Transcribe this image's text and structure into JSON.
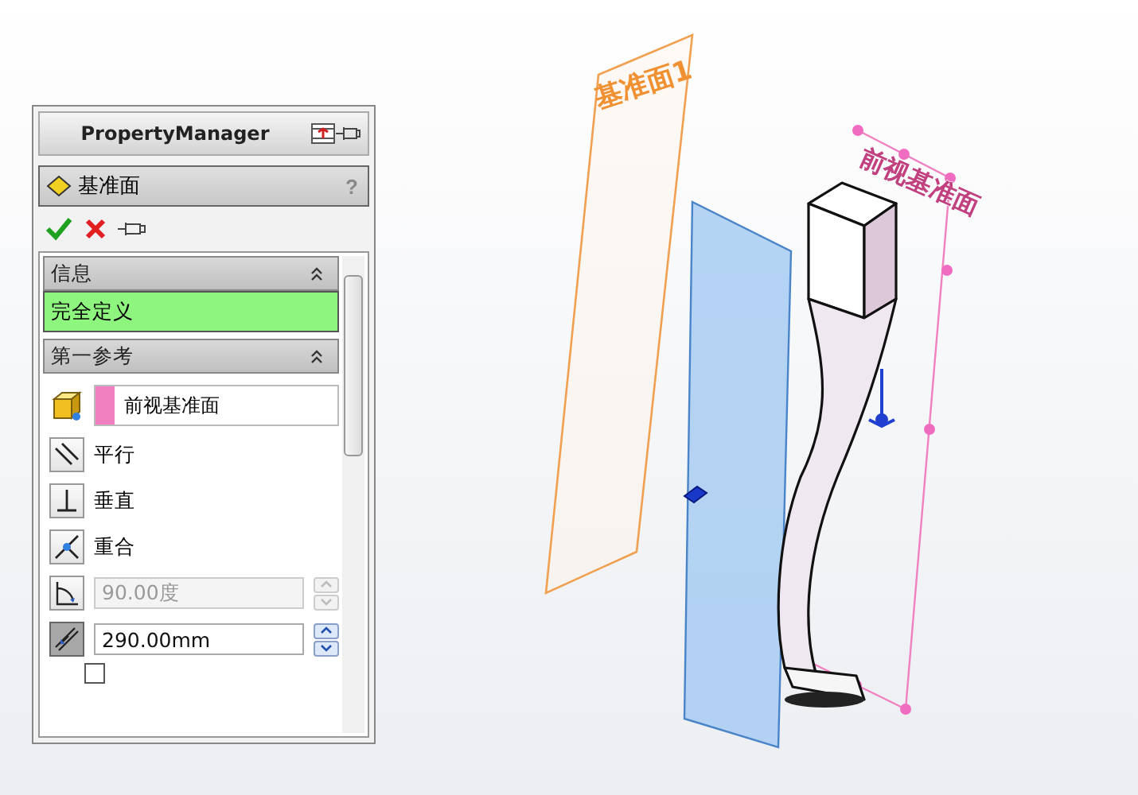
{
  "panel": {
    "title": "PropertyManager",
    "feature": {
      "title": "基准面",
      "help": "?"
    },
    "sections": [
      {
        "title": "信息",
        "expanded": true,
        "message": "完全定义"
      },
      {
        "title": "第一参考",
        "expanded": true,
        "reference": "前视基准面"
      }
    ],
    "constraints": [
      {
        "kind": "parallel",
        "label": "平行",
        "selected": false
      },
      {
        "kind": "perpendicular",
        "label": "垂直",
        "selected": false
      },
      {
        "kind": "coincident",
        "label": "重合",
        "selected": false
      },
      {
        "kind": "angle",
        "value": "90.00度",
        "selected": false,
        "disabled": true
      },
      {
        "kind": "distance",
        "value": "290.00mm",
        "selected": true,
        "disabled": false
      }
    ],
    "flip_checkbox": {
      "checked": false
    }
  },
  "viewport": {
    "planes": [
      {
        "kind": "new",
        "label": "基准面1"
      },
      {
        "kind": "front",
        "label": "前视基准面"
      }
    ]
  }
}
